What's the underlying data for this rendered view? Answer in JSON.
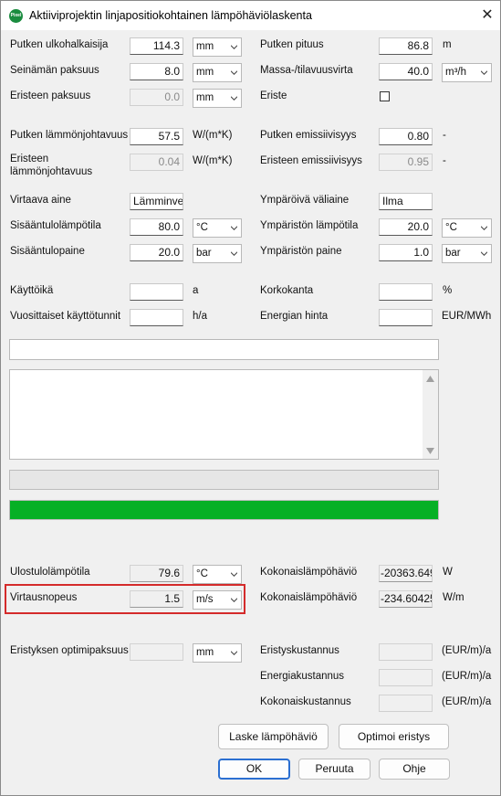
{
  "window": {
    "title": "Aktiiviprojektin linjapositiokohtainen lämpöhäviölaskenta",
    "icon_text": "Pixel",
    "close_glyph": "✕"
  },
  "left": {
    "outer_diameter": {
      "label": "Putken ulkohalkaisija",
      "value": "114.3",
      "unit": "mm"
    },
    "wall_thickness": {
      "label": "Seinämän paksuus",
      "value": "8.0",
      "unit": "mm"
    },
    "insulation_thickness": {
      "label": "Eristeen paksuus",
      "value": "0.0",
      "unit": "mm"
    },
    "pipe_conductivity": {
      "label": "Putken lämmönjohtavuus",
      "value": "57.5",
      "unit": "W/(m*K)"
    },
    "insulation_conductivity": {
      "label": "Eristeen lämmönjohtavuus",
      "value": "0.04",
      "unit": "W/(m*K)"
    },
    "fluid": {
      "label": "Virtaava aine",
      "value": "Lämminvesi"
    },
    "inlet_temp": {
      "label": "Sisääntulolämpötila",
      "value": "80.0",
      "unit": "°C"
    },
    "inlet_pressure": {
      "label": "Sisääntulopaine",
      "value": "20.0",
      "unit": "bar"
    },
    "operating_age": {
      "label": "Käyttöikä",
      "value": "",
      "unit": "a"
    },
    "annual_hours": {
      "label": "Vuosittaiset käyttötunnit",
      "value": "",
      "unit": "h/a"
    }
  },
  "right": {
    "pipe_length": {
      "label": "Putken pituus",
      "value": "86.8",
      "unit": "m"
    },
    "mass_flow": {
      "label": "Massa-/tilavuusvirta",
      "value": "40.0",
      "unit": "m³/h"
    },
    "insulation": {
      "label": "Eriste",
      "checked": false
    },
    "pipe_emissivity": {
      "label": "Putken emissiivisyys",
      "value": "0.80",
      "unit": "-"
    },
    "insulation_emissivity": {
      "label": "Eristeen emissiivisyys",
      "value": "0.95",
      "unit": "-"
    },
    "ambient_medium": {
      "label": "Ympäröivä väliaine",
      "value": "Ilma"
    },
    "ambient_temp": {
      "label": "Ympäristön lämpötila",
      "value": "20.0",
      "unit": "°C"
    },
    "ambient_pressure": {
      "label": "Ympäristön paine",
      "value": "1.0",
      "unit": "bar"
    },
    "altitude": {
      "label": "Korkokanta",
      "value": "",
      "unit": "%"
    },
    "energy_price": {
      "label": "Energian hinta",
      "value": "",
      "unit": "EUR/MWh"
    }
  },
  "status_line": "",
  "log_text": "",
  "progress": {
    "upper_fraction": 0.0,
    "lower_fraction": 1.0,
    "fill_color": "#06b025"
  },
  "results": {
    "outlet_temp": {
      "label": "Ulostulolämpötila",
      "value": "79.6",
      "unit": "°C"
    },
    "flow_velocity": {
      "label": "Virtausnopeus",
      "value": "1.5",
      "unit": "m/s"
    },
    "total_heat_loss": {
      "label": "Kokonaislämpöhäviö",
      "value": "-20363.649",
      "unit": "W"
    },
    "heat_loss_per_m": {
      "label": "Kokonaislämpöhäviö",
      "value": "-234.60425",
      "unit": "W/m"
    },
    "optimal_thickness": {
      "label": "Eristyksen optimipaksuus",
      "value": "",
      "unit": "mm"
    },
    "insulation_cost": {
      "label": "Eristyskustannus",
      "value": "",
      "unit": "(EUR/m)/a"
    },
    "energy_cost": {
      "label": "Energiakustannus",
      "value": "",
      "unit": "(EUR/m)/a"
    },
    "total_cost": {
      "label": "Kokonaiskustannus",
      "value": "",
      "unit": "(EUR/m)/a"
    }
  },
  "buttons": {
    "calculate": "Laske lämpöhäviö",
    "optimize": "Optimoi eristys",
    "ok": "OK",
    "cancel": "Peruuta",
    "help": "Ohje"
  },
  "colors": {
    "highlight": "#d42b2b",
    "progress_green": "#06b025",
    "default_button_border": "#2b6fd1"
  }
}
